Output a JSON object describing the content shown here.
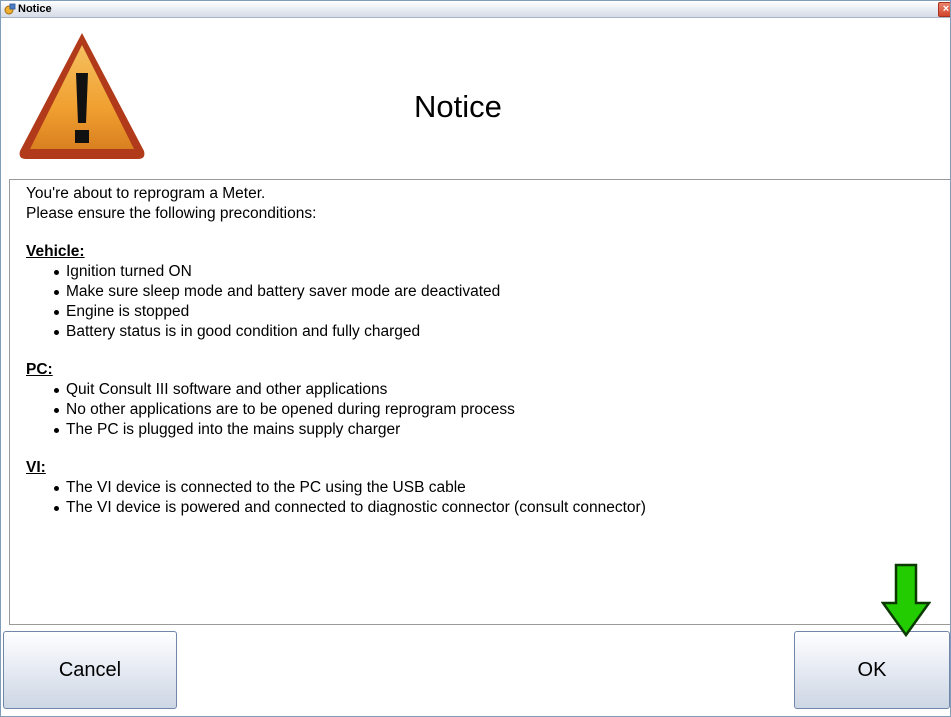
{
  "window": {
    "title": "Notice",
    "close_glyph": "×"
  },
  "header": {
    "heading": "Notice",
    "icon": "warning-icon"
  },
  "content": {
    "intro_lines": [
      "You're about to reprogram a Meter.",
      "Please ensure the following preconditions:"
    ],
    "sections": [
      {
        "title": "Vehicle:",
        "items": [
          "Ignition turned ON",
          "Make sure sleep mode and battery saver mode are deactivated",
          "Engine is stopped",
          "Battery status is in good condition and fully charged"
        ]
      },
      {
        "title": "PC:",
        "items": [
          "Quit Consult III software and other applications",
          "No other applications are to be opened during reprogram process",
          "The PC is plugged into the mains supply charger"
        ]
      },
      {
        "title": "VI:",
        "items": [
          "The VI device is connected to the PC using the USB cable",
          "The VI device is powered and connected to diagnostic connector (consult connector)"
        ]
      }
    ]
  },
  "buttons": {
    "cancel_label": "Cancel",
    "ok_label": "OK"
  },
  "annotation": {
    "icon": "arrow-down-icon",
    "color": "#22cc00"
  }
}
